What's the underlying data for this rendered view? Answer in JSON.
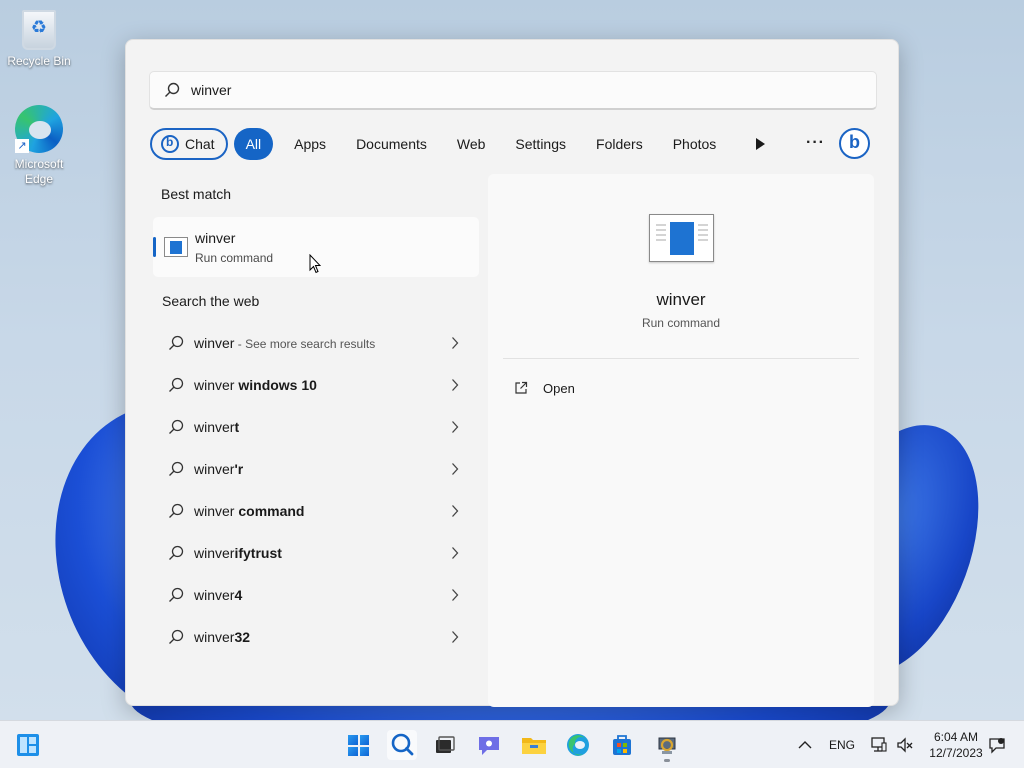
{
  "desktop": {
    "icons": [
      {
        "label": "Recycle Bin",
        "icon": "recycle-bin-icon"
      },
      {
        "label": "Microsoft Edge",
        "icon": "edge-icon"
      }
    ]
  },
  "search": {
    "query": "winver",
    "filters": [
      {
        "label": "Chat",
        "id": "chat"
      },
      {
        "label": "All",
        "id": "all",
        "selected": true
      },
      {
        "label": "Apps",
        "id": "apps"
      },
      {
        "label": "Documents",
        "id": "documents"
      },
      {
        "label": "Web",
        "id": "web"
      },
      {
        "label": "Settings",
        "id": "settings"
      },
      {
        "label": "Folders",
        "id": "folders"
      },
      {
        "label": "Photos",
        "id": "photos"
      }
    ],
    "more_label": "···",
    "best_match_header": "Best match",
    "best_match": {
      "title": "winver",
      "subtitle": "Run command"
    },
    "web_header": "Search the web",
    "web_results": [
      {
        "prefix": "winver",
        "suffix": "",
        "note": " - See more search results"
      },
      {
        "prefix": "winver",
        "suffix": " windows 10",
        "note": ""
      },
      {
        "prefix": "winver",
        "suffix": "t",
        "note": ""
      },
      {
        "prefix": "winver",
        "suffix": "'r",
        "note": ""
      },
      {
        "prefix": "winver",
        "suffix": " command",
        "note": ""
      },
      {
        "prefix": "winver",
        "suffix": "ifytrust",
        "note": ""
      },
      {
        "prefix": "winver",
        "suffix": "4",
        "note": ""
      },
      {
        "prefix": "winver",
        "suffix": "32",
        "note": ""
      }
    ]
  },
  "detail": {
    "title": "winver",
    "subtitle": "Run command",
    "actions": [
      {
        "label": "Open",
        "icon": "open-external-icon"
      }
    ]
  },
  "taskbar": {
    "tray": {
      "language": "ENG",
      "time": "6:04 AM",
      "date": "12/7/2023"
    }
  },
  "colors": {
    "accent": "#1565c6",
    "panel": "#f3f3f3",
    "taskbar": "#eef1f6"
  }
}
